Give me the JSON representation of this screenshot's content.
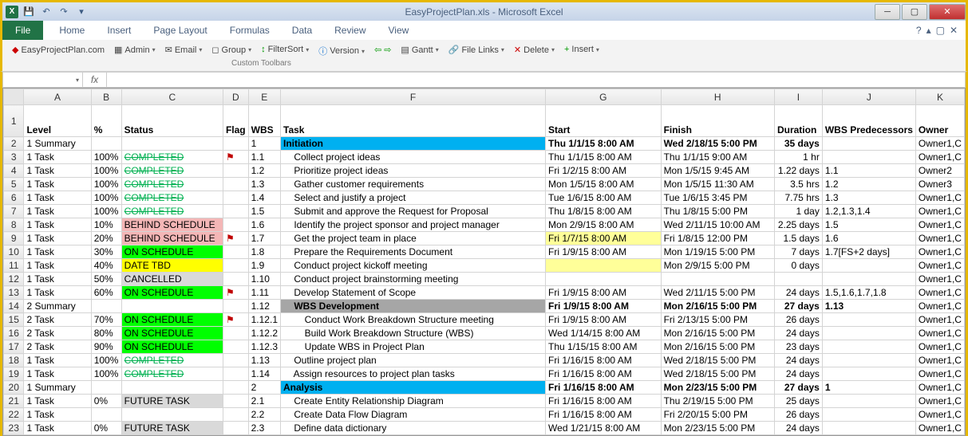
{
  "window": {
    "title": "EasyProjectPlan.xls  -  Microsoft Excel",
    "qat": {
      "save": "💾",
      "undo": "↶",
      "redo": "↷"
    },
    "minimize": "─",
    "maximize": "▢",
    "close": "✕"
  },
  "ribbon": {
    "file": "File",
    "tabs": [
      "Home",
      "Insert",
      "Page Layout",
      "Formulas",
      "Data",
      "Review",
      "View"
    ],
    "help": [
      "ⓘ",
      "❍",
      "▢",
      "✕"
    ]
  },
  "addin": {
    "site": "EasyProjectPlan.com",
    "admin": "Admin",
    "email": "Email",
    "group": "Group",
    "filtersort": "FilterSort",
    "version": "Version",
    "gantt": "Gantt",
    "filelinks": "File Links",
    "delete": "Delete",
    "insert": "Insert",
    "label": "Custom Toolbars"
  },
  "formula": {
    "namebox": "",
    "fx": "fx",
    "value": ""
  },
  "columns": [
    "A",
    "B",
    "C",
    "D",
    "E",
    "F",
    "G",
    "H",
    "I",
    "J",
    "K"
  ],
  "headers": {
    "A": "Level",
    "B": "%",
    "C": "Status",
    "D": "Flag",
    "E": "WBS",
    "F": "Task",
    "G": "Start",
    "H": "Finish",
    "I": "Duration",
    "J": "WBS Predecessors",
    "K": "Owner"
  },
  "rows": [
    {
      "n": 2,
      "A": "1 Summary",
      "B": "",
      "C": "",
      "D": "",
      "E": "1",
      "F": "Initiation",
      "G": "Thu 1/1/15 8:00 AM",
      "H": "Wed 2/18/15 5:00 PM",
      "I": "35 days",
      "J": "",
      "K": "Owner1,C",
      "style": "initiation",
      "summary": true
    },
    {
      "n": 3,
      "A": "1 Task",
      "B": "100%",
      "C": "COMPLETED",
      "D": "⚑",
      "E": "1.1",
      "F": "    Collect project ideas",
      "G": "Thu 1/1/15 8:00 AM",
      "H": "Thu 1/1/15 9:00 AM",
      "I": "1 hr",
      "J": "",
      "K": "Owner1,C",
      "cStyle": "completed",
      "flag": true
    },
    {
      "n": 4,
      "A": "1 Task",
      "B": "100%",
      "C": "COMPLETED",
      "D": "",
      "E": "1.2",
      "F": "    Prioritize project ideas",
      "G": "Fri 1/2/15 8:00 AM",
      "H": "Mon 1/5/15 9:45 AM",
      "I": "1.22 days",
      "J": "1.1",
      "K": "Owner2",
      "cStyle": "completed"
    },
    {
      "n": 5,
      "A": "1 Task",
      "B": "100%",
      "C": "COMPLETED",
      "D": "",
      "E": "1.3",
      "F": "    Gather customer requirements",
      "G": "Mon 1/5/15 8:00 AM",
      "H": "Mon 1/5/15 11:30 AM",
      "I": "3.5 hrs",
      "J": "1.2",
      "K": "Owner3",
      "cStyle": "completed"
    },
    {
      "n": 6,
      "A": "1 Task",
      "B": "100%",
      "C": "COMPLETED",
      "D": "",
      "E": "1.4",
      "F": "    Select and justify a project",
      "G": "Tue 1/6/15 8:00 AM",
      "H": "Tue 1/6/15 3:45 PM",
      "I": "7.75 hrs",
      "J": "1.3",
      "K": "Owner1,C",
      "cStyle": "completed"
    },
    {
      "n": 7,
      "A": "1 Task",
      "B": "100%",
      "C": "COMPLETED",
      "D": "",
      "E": "1.5",
      "F": "    Submit and approve the Request for Proposal",
      "G": "Thu 1/8/15 8:00 AM",
      "H": "Thu 1/8/15 5:00 PM",
      "I": "1 day",
      "J": "1.2,1.3,1.4",
      "K": "Owner1,C",
      "cStyle": "completed"
    },
    {
      "n": 8,
      "A": "1 Task",
      "B": "10%",
      "C": "BEHIND SCHEDULE",
      "D": "",
      "E": "1.6",
      "F": "    Identify the project sponsor and project manager",
      "G": "Mon 2/9/15 8:00 AM",
      "H": "Wed 2/11/15 10:00 AM",
      "I": "2.25 days",
      "J": "1.5",
      "K": "Owner1,C",
      "cStyle": "behind"
    },
    {
      "n": 9,
      "A": "1 Task",
      "B": "20%",
      "C": "BEHIND SCHEDULE",
      "D": "⚑",
      "E": "1.7",
      "F": "    Get the project team in place",
      "G": "Fri 1/7/15 8:00 AM",
      "H": "Fri 1/8/15 12:00 PM",
      "I": "1.5 days",
      "J": "1.6",
      "K": "Owner1,C",
      "cStyle": "behind",
      "flag": true,
      "yellowG": true
    },
    {
      "n": 10,
      "A": "1 Task",
      "B": "30%",
      "C": "ON SCHEDULE",
      "D": "",
      "E": "1.8",
      "F": "    Prepare the Requirements Document",
      "G": "Fri 1/9/15 8:00 AM",
      "H": "Mon 1/19/15 5:00 PM",
      "I": "7 days",
      "J": "1.7[FS+2 days]",
      "K": "Owner1,C",
      "cStyle": "onsched"
    },
    {
      "n": 11,
      "A": "1 Task",
      "B": "40%",
      "C": "DATE TBD",
      "D": "",
      "E": "1.9",
      "F": "    Conduct project kickoff meeting",
      "G": "",
      "H": "Mon 2/9/15 5:00 PM",
      "I": "0 days",
      "J": "",
      "K": "Owner1,C",
      "cStyle": "datetbd",
      "yellowG": true
    },
    {
      "n": 12,
      "A": "1 Task",
      "B": "50%",
      "C": "CANCELLED",
      "D": "",
      "E": "1.10",
      "F": "    Conduct project brainstorming meeting",
      "G": "",
      "H": "",
      "I": "",
      "J": "",
      "K": "Owner1,C",
      "cStyle": "cancelled"
    },
    {
      "n": 13,
      "A": "1 Task",
      "B": "60%",
      "C": "ON SCHEDULE",
      "D": "⚑",
      "E": "1.11",
      "F": "    Develop Statement of Scope",
      "G": "Fri 1/9/15 8:00 AM",
      "H": "Wed 2/11/15 5:00 PM",
      "I": "24 days",
      "J": "1.5,1.6,1.7,1.8",
      "K": "Owner1,C",
      "cStyle": "onsched",
      "flag": true
    },
    {
      "n": 14,
      "A": "2 Summary",
      "B": "",
      "C": "",
      "D": "",
      "E": "1.12",
      "F": "    WBS Development",
      "G": "Fri 1/9/15 8:00 AM",
      "H": "Mon 2/16/15 5:00 PM",
      "I": "27 days",
      "J": "1.13",
      "K": "Owner1,C",
      "style": "wbsdev",
      "summary": true
    },
    {
      "n": 15,
      "A": "2 Task",
      "B": "70%",
      "C": "ON SCHEDULE",
      "D": "⚑",
      "E": "1.12.1",
      "F": "        Conduct Work Breakdown Structure meeting",
      "G": "Fri 1/9/15 8:00 AM",
      "H": "Fri 2/13/15 5:00 PM",
      "I": "26 days",
      "J": "",
      "K": "Owner1,C",
      "cStyle": "onsched",
      "flag": true
    },
    {
      "n": 16,
      "A": "2 Task",
      "B": "80%",
      "C": "ON SCHEDULE",
      "D": "",
      "E": "1.12.2",
      "F": "        Build Work Breakdown Structure (WBS)",
      "G": "Wed 1/14/15 8:00 AM",
      "H": "Mon 2/16/15 5:00 PM",
      "I": "24 days",
      "J": "",
      "K": "Owner1,C",
      "cStyle": "onsched"
    },
    {
      "n": 17,
      "A": "2 Task",
      "B": "90%",
      "C": "ON SCHEDULE",
      "D": "",
      "E": "1.12.3",
      "F": "        Update WBS in Project Plan",
      "G": "Thu 1/15/15 8:00 AM",
      "H": "Mon 2/16/15 5:00 PM",
      "I": "23 days",
      "J": "",
      "K": "Owner1,C",
      "cStyle": "onsched"
    },
    {
      "n": 18,
      "A": "1 Task",
      "B": "100%",
      "C": "COMPLETED",
      "D": "",
      "E": "1.13",
      "F": "    Outline project plan",
      "G": "Fri 1/16/15 8:00 AM",
      "H": "Wed 2/18/15 5:00 PM",
      "I": "24 days",
      "J": "",
      "K": "Owner1,C",
      "cStyle": "completed"
    },
    {
      "n": 19,
      "A": "1 Task",
      "B": "100%",
      "C": "COMPLETED",
      "D": "",
      "E": "1.14",
      "F": "    Assign resources to project plan tasks",
      "G": "Fri 1/16/15 8:00 AM",
      "H": "Wed 2/18/15 5:00 PM",
      "I": "24 days",
      "J": "",
      "K": "Owner1,C",
      "cStyle": "completed"
    },
    {
      "n": 20,
      "A": "1 Summary",
      "B": "",
      "C": "",
      "D": "",
      "E": "2",
      "F": "Analysis",
      "G": "Fri 1/16/15 8:00 AM",
      "H": "Mon 2/23/15 5:00 PM",
      "I": "27 days",
      "J": "1",
      "K": "Owner1,C",
      "style": "analysis",
      "summary": true
    },
    {
      "n": 21,
      "A": "1 Task",
      "B": "0%",
      "C": "FUTURE TASK",
      "D": "",
      "E": "2.1",
      "F": "    Create Entity Relationship Diagram",
      "G": "Fri 1/16/15 8:00 AM",
      "H": "Thu 2/19/15 5:00 PM",
      "I": "25 days",
      "J": "",
      "K": "Owner1,C",
      "cStyle": "future"
    },
    {
      "n": 22,
      "A": "1 Task",
      "B": "",
      "C": "",
      "D": "",
      "E": "2.2",
      "F": "    Create Data Flow Diagram",
      "G": "Fri 1/16/15 8:00 AM",
      "H": "Fri 2/20/15 5:00 PM",
      "I": "26 days",
      "J": "",
      "K": "Owner1,C"
    },
    {
      "n": 23,
      "A": "1 Task",
      "B": "0%",
      "C": "FUTURE TASK",
      "D": "",
      "E": "2.3",
      "F": "    Define data dictionary",
      "G": "Wed 1/21/15 8:00 AM",
      "H": "Mon 2/23/15 5:00 PM",
      "I": "24 days",
      "J": "",
      "K": "Owner1,C",
      "cStyle": "future"
    }
  ]
}
